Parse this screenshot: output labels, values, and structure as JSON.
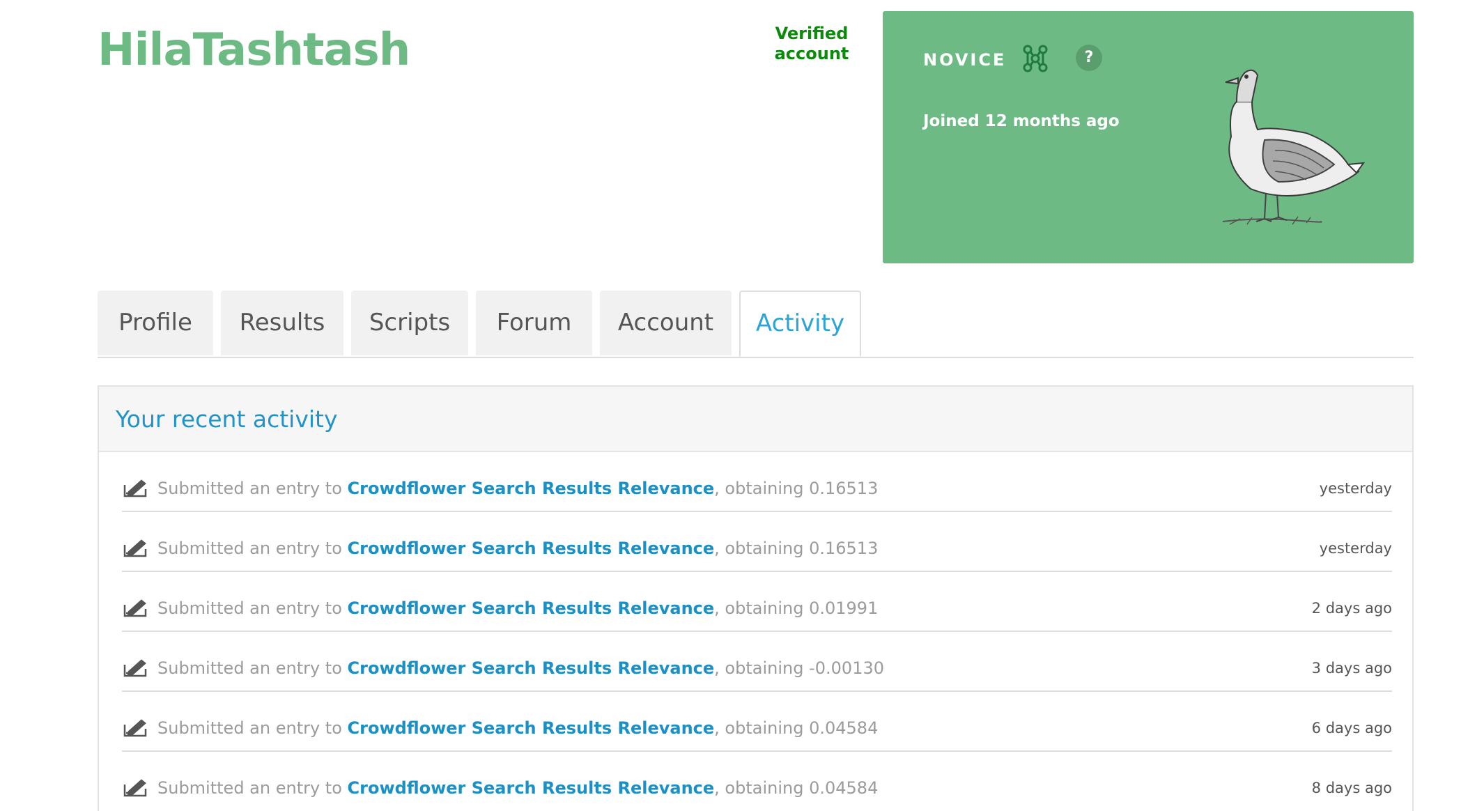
{
  "profile": {
    "username": "HilaTashtash",
    "verified_line1": "Verified",
    "verified_line2": "account"
  },
  "tier_card": {
    "tier": "NOVICE",
    "tier_icon": "molecule-icon",
    "help_label": "?",
    "joined": "Joined 12 months ago",
    "background_color": "#6dba84",
    "illustration": "goose-illustration"
  },
  "tabs": [
    {
      "label": "Profile",
      "active": false
    },
    {
      "label": "Results",
      "active": false
    },
    {
      "label": "Scripts",
      "active": false
    },
    {
      "label": "Forum",
      "active": false
    },
    {
      "label": "Account",
      "active": false
    },
    {
      "label": "Activity",
      "active": true
    }
  ],
  "activity": {
    "title": "Your recent activity",
    "prefix_text": "Submitted an entry to ",
    "obtaining_text": ", obtaining ",
    "items": [
      {
        "competition": "Crowdflower Search Results Relevance",
        "score": "0.16513",
        "time": "yesterday"
      },
      {
        "competition": "Crowdflower Search Results Relevance",
        "score": "0.16513",
        "time": "yesterday"
      },
      {
        "competition": "Crowdflower Search Results Relevance",
        "score": "0.01991",
        "time": "2 days ago"
      },
      {
        "competition": "Crowdflower Search Results Relevance",
        "score": "-0.00130",
        "time": "3 days ago"
      },
      {
        "competition": "Crowdflower Search Results Relevance",
        "score": "0.04584",
        "time": "6 days ago"
      },
      {
        "competition": "Crowdflower Search Results Relevance",
        "score": "0.04584",
        "time": "8 days ago"
      }
    ]
  },
  "colors": {
    "brand_green": "#6dba84",
    "verified_green": "#0b8a0b",
    "link_blue": "#1c8fc5",
    "active_tab_blue": "#2aa3d6"
  }
}
